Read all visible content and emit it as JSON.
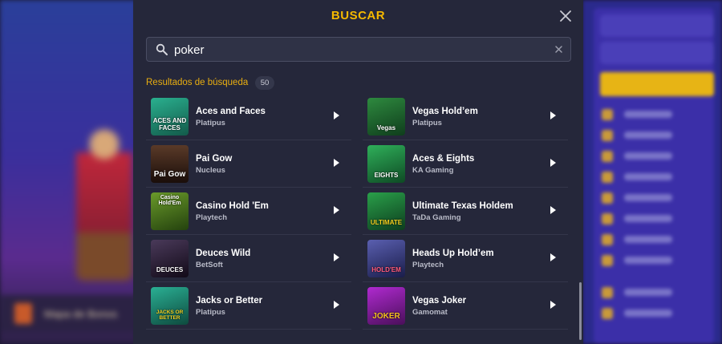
{
  "modal": {
    "title": "BUSCAR",
    "search_value": "poker",
    "results_label": "Resultados de búsqueda",
    "results_count": "50"
  },
  "background": {
    "left_banner": "Mapa de Bonos"
  },
  "results": [
    {
      "name": "Aces and Faces",
      "provider": "Platipus",
      "thumb_text": "ACES AND FACES",
      "thumb_color": "#1e8a7a"
    },
    {
      "name": "Vegas Hold’em",
      "provider": "Platipus",
      "thumb_text": "Vegas",
      "thumb_color": "#1f6b35"
    },
    {
      "name": "Pai Gow",
      "provider": "Nucleus",
      "thumb_text": "Pai Gow",
      "thumb_color": "#3a2218"
    },
    {
      "name": "Aces & Eights",
      "provider": "KA Gaming",
      "thumb_text": "EIGHTS",
      "thumb_color": "#1d8a3c"
    },
    {
      "name": "Casino Hold 'Em",
      "provider": "Playtech",
      "thumb_text": "Casino Hold'Em",
      "thumb_color": "#3f6a1c"
    },
    {
      "name": "Ultimate Texas Holdem",
      "provider": "TaDa Gaming",
      "thumb_text": "ULTIMATE",
      "thumb_color": "#1a7a3a"
    },
    {
      "name": "Deuces Wild",
      "provider": "BetSoft",
      "thumb_text": "DEUCES",
      "thumb_color": "#2a1d33"
    },
    {
      "name": "Heads Up Hold’em",
      "provider": "Playtech",
      "thumb_text": "HOLD'EM",
      "thumb_color": "#3b3f78"
    },
    {
      "name": "Jacks or Better",
      "provider": "Platipus",
      "thumb_text": "JACKS OR BETTER",
      "thumb_color": "#1b8a72"
    },
    {
      "name": "Vegas Joker",
      "provider": "Gamomat",
      "thumb_text": "JOKER",
      "thumb_color": "#8a1f9a"
    }
  ]
}
